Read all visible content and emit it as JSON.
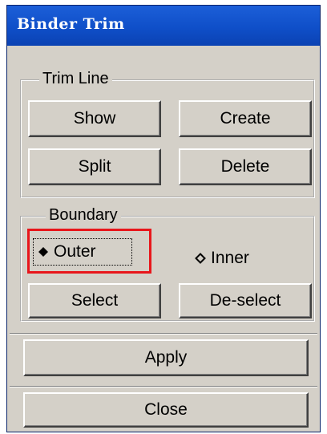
{
  "window": {
    "title": "Binder Trim"
  },
  "trim_line": {
    "legend": "Trim Line",
    "show_label": "Show",
    "create_label": "Create",
    "split_label": "Split",
    "delete_label": "Delete"
  },
  "boundary": {
    "legend": "Boundary",
    "outer_label": "Outer",
    "inner_label": "Inner",
    "selected": "Outer",
    "select_label": "Select",
    "deselect_label": "De-select"
  },
  "footer": {
    "apply_label": "Apply",
    "close_label": "Close"
  },
  "colors": {
    "title_bar": "#0f4fc9",
    "dialog_bg": "#d4d0c8",
    "highlight": "#e8161b"
  }
}
